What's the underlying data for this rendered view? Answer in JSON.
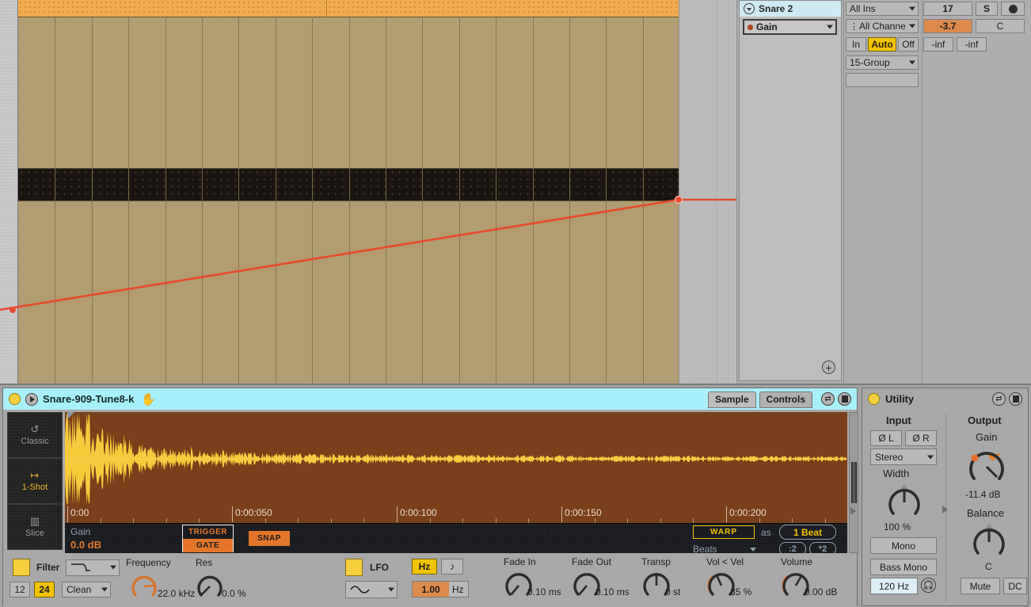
{
  "arrangement": {
    "clip_name": "",
    "automation_color": "#e84a2f"
  },
  "track": {
    "title": "Snare 2",
    "device_slot": "Gain",
    "io": {
      "input_type": "All Ins",
      "input_channel": "All Channe",
      "monitor": {
        "in": "In",
        "auto": "Auto",
        "off": "Off"
      },
      "output_type": "15-Group",
      "output_channel": ""
    },
    "mixer": {
      "track_number": "17",
      "solo": "S",
      "arm_icon": "record-arm-icon",
      "volume": "-3.7",
      "pan": "C",
      "peak_left": "-inf",
      "peak_right": "-inf"
    },
    "add_button": "+"
  },
  "simpler": {
    "led": "device-on-led",
    "preview_icon": "play-icon",
    "name": "Snare-909-Tune8-k",
    "cursor_icon": "hand-cursor",
    "tabs": [
      {
        "label": "Sample",
        "active": true
      },
      {
        "label": "Controls",
        "active": false
      }
    ],
    "header_icons": [
      "hot-swap-icon",
      "save-preset-icon"
    ],
    "modes": [
      {
        "icon": "loop-icon",
        "label": "Classic",
        "selected": false
      },
      {
        "icon": "one-shot-icon",
        "label": "1-Shot",
        "selected": true
      },
      {
        "icon": "slice-icon",
        "label": "Slice",
        "selected": false
      }
    ],
    "ruler_labels": [
      "0:00",
      "0:00:050",
      "0:00:100",
      "0:00:150",
      "0:00:200"
    ],
    "gain_label": "Gain",
    "gain_value": "0.0 dB",
    "trigger_label": "TRIGGER",
    "gate_label": "GATE",
    "snap_label": "SNAP",
    "warp_label": "WARP",
    "as_label": "as",
    "warp_beats": "1 Beat",
    "warp_mode": "Beats",
    "warp_half": ":2",
    "warp_double": "*2"
  },
  "controls": {
    "filter": {
      "enabled_swatch": "filter-on",
      "label": "Filter",
      "shape": "lowpass-icon",
      "slope_12": "12",
      "slope_24": "24",
      "slope_active": "24",
      "circuit": "Clean",
      "freq_label": "Frequency",
      "freq_value": "22.0 kHz",
      "res_label": "Res",
      "res_value": "0.0 %"
    },
    "lfo": {
      "enabled_swatch": "lfo-on",
      "label": "LFO",
      "shape": "sine-icon",
      "hz_label": "Hz",
      "note_icon": "note-icon",
      "rate_value": "1.00",
      "rate_unit": "Hz"
    },
    "knobs": [
      {
        "label": "Fade In",
        "value": "0.10 ms"
      },
      {
        "label": "Fade Out",
        "value": "0.10 ms"
      },
      {
        "label": "Transp",
        "value": "0 st"
      },
      {
        "label": "Vol < Vel",
        "value": "35 %"
      },
      {
        "label": "Volume",
        "value": "0.00 dB"
      }
    ]
  },
  "utility": {
    "led": "device-on-led",
    "name": "Utility",
    "header_icons": [
      "hot-swap-icon",
      "save-preset-icon"
    ],
    "input": {
      "heading": "Input",
      "phase_l": "Ø L",
      "phase_r": "Ø R",
      "mode": "Stereo",
      "width_label": "Width",
      "width_value": "100 %",
      "mono": "Mono",
      "bass_mono": "Bass Mono",
      "bass_freq": "120 Hz",
      "listen_icon": "headphone-icon"
    },
    "output": {
      "heading": "Output",
      "gain_label": "Gain",
      "gain_value": "-11.4 dB",
      "balance_label": "Balance",
      "balance_value": "C",
      "mute": "Mute",
      "dc": "DC"
    }
  }
}
